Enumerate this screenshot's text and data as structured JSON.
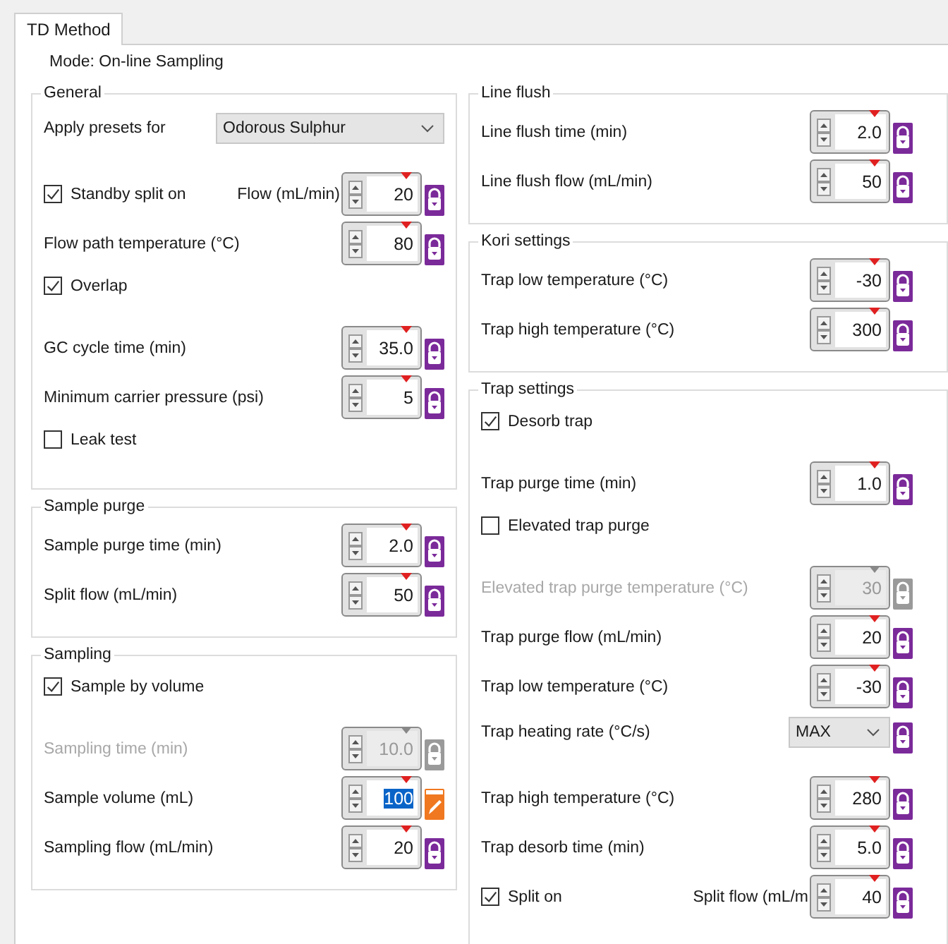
{
  "tabs": [
    {
      "label": "TD Method",
      "selected": true
    }
  ],
  "mode": "Mode: On-line Sampling",
  "left_groups": [
    {
      "title": "General",
      "rows": [
        {
          "kind": "select",
          "label": "Apply presets for",
          "value": "Odorous Sulphur"
        },
        {
          "kind": "checkspin",
          "label": "Standby split on",
          "checked": true,
          "label2": "Flow (mL/min)",
          "value": "20",
          "disabled": false,
          "highlighted": false,
          "editing": false
        },
        {
          "kind": "spin",
          "label": "Flow path temperature (°C)",
          "value": "80",
          "disabled": false,
          "highlighted": false,
          "editing": false
        },
        {
          "kind": "check",
          "label": "Overlap",
          "checked": true
        },
        {
          "kind": "spin",
          "label": "GC cycle time (min)",
          "value": "35.0",
          "disabled": false,
          "highlighted": false,
          "editing": false
        },
        {
          "kind": "spin",
          "label": "Minimum carrier pressure (psi)",
          "value": "5",
          "disabled": false,
          "highlighted": false,
          "editing": false
        },
        {
          "kind": "check",
          "label": "Leak test",
          "checked": false
        }
      ]
    },
    {
      "title": "Sample purge",
      "rows": [
        {
          "kind": "spin",
          "label": "Sample purge time (min)",
          "value": "2.0",
          "disabled": false,
          "highlighted": false,
          "editing": false
        },
        {
          "kind": "spin",
          "label": "Split flow (mL/min)",
          "value": "50",
          "disabled": false,
          "highlighted": false,
          "editing": false
        }
      ]
    },
    {
      "title": "Sampling",
      "rows": [
        {
          "kind": "check",
          "label": "Sample by volume",
          "checked": true
        },
        {
          "kind": "spin",
          "label": "Sampling time (min)",
          "value": "10.0",
          "disabled": true,
          "highlighted": false,
          "editing": false
        },
        {
          "kind": "spin",
          "label": "Sample volume (mL)",
          "value": "100",
          "disabled": false,
          "highlighted": true,
          "editing": true
        },
        {
          "kind": "spin",
          "label": "Sampling flow (mL/min)",
          "value": "20",
          "disabled": false,
          "highlighted": false,
          "editing": false
        }
      ]
    }
  ],
  "right_groups": [
    {
      "title": "Line flush",
      "rows": [
        {
          "kind": "spin",
          "label": "Line flush time (min)",
          "value": "2.0",
          "disabled": false,
          "highlighted": false,
          "editing": false
        },
        {
          "kind": "spin",
          "label": "Line flush flow (mL/min)",
          "value": "50",
          "disabled": false,
          "highlighted": false,
          "editing": false
        }
      ]
    },
    {
      "title": "Kori settings",
      "rows": [
        {
          "kind": "spin",
          "label": "Trap low temperature (°C)",
          "value": "-30",
          "disabled": false,
          "highlighted": false,
          "editing": false
        },
        {
          "kind": "spin",
          "label": "Trap high temperature (°C)",
          "value": "300",
          "disabled": false,
          "highlighted": false,
          "editing": false
        }
      ]
    },
    {
      "title": "Trap settings",
      "rows": [
        {
          "kind": "check",
          "label": "Desorb trap",
          "checked": true
        },
        {
          "kind": "spin",
          "label": "Trap purge time (min)",
          "value": "1.0",
          "disabled": false,
          "highlighted": false,
          "editing": false
        },
        {
          "kind": "check",
          "label": "Elevated trap purge",
          "checked": false
        },
        {
          "kind": "spin",
          "label": "Elevated trap purge temperature (°C)",
          "value": "30",
          "disabled": true,
          "highlighted": false,
          "editing": false
        },
        {
          "kind": "spin",
          "label": "Trap purge flow (mL/min)",
          "value": "20",
          "disabled": false,
          "highlighted": false,
          "editing": false
        },
        {
          "kind": "spin",
          "label": "Trap low temperature (°C)",
          "value": "-30",
          "disabled": false,
          "highlighted": false,
          "editing": false
        },
        {
          "kind": "select",
          "label": "Trap heating rate (°C/s)",
          "value": "MAX",
          "editing": false
        },
        {
          "kind": "spin",
          "label": "Trap high temperature (°C)",
          "value": "280",
          "disabled": false,
          "highlighted": false,
          "editing": false
        },
        {
          "kind": "spin",
          "label": "Trap desorb time (min)",
          "value": "5.0",
          "disabled": false,
          "highlighted": false,
          "editing": false
        },
        {
          "kind": "checkspin",
          "label": "Split on",
          "checked": true,
          "label2": "Split flow (mL/m",
          "value": "40",
          "disabled": false,
          "highlighted": false,
          "editing": false
        }
      ]
    }
  ]
}
